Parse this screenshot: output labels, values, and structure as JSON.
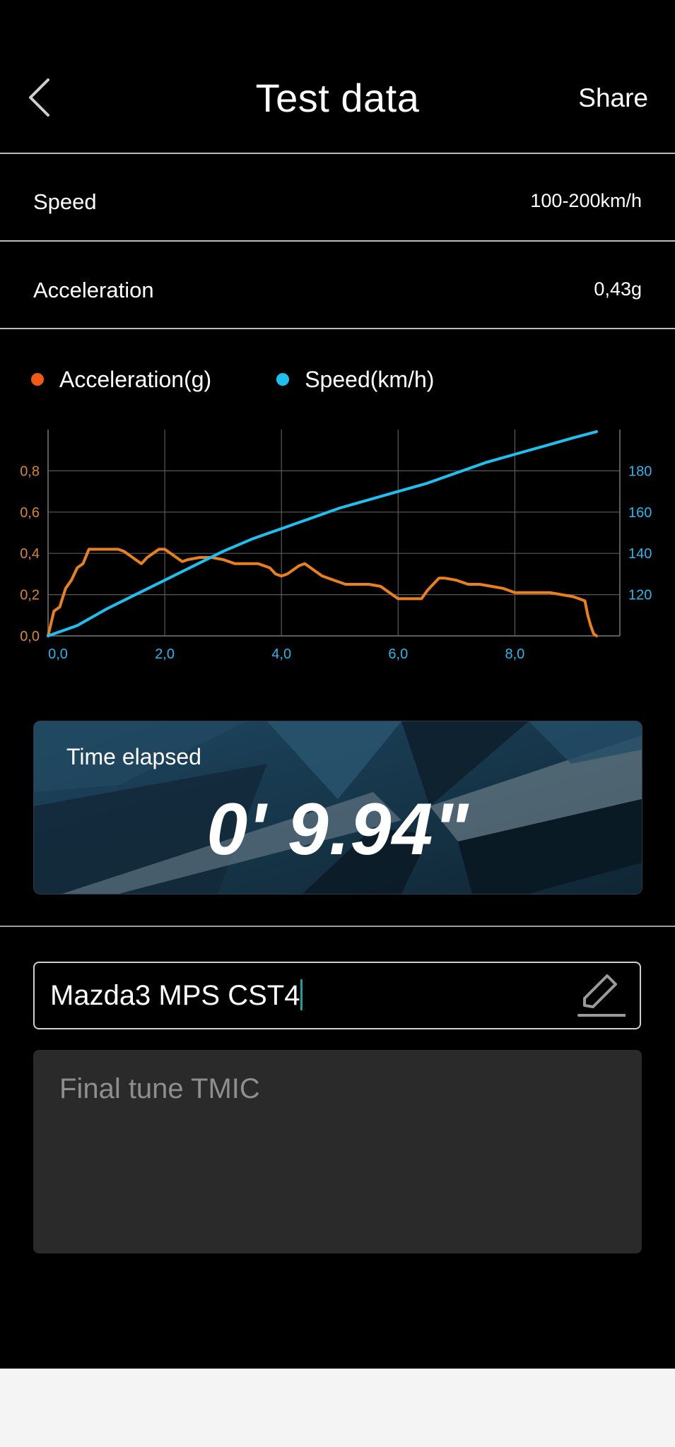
{
  "header": {
    "title": "Test data",
    "share_label": "Share",
    "back_icon": "chevron-left-icon"
  },
  "rows": [
    {
      "label": "Speed",
      "value": "100-200km/h"
    },
    {
      "label": "Acceleration",
      "value": "0,43g"
    }
  ],
  "legend": {
    "acceleration": {
      "label": "Acceleration(g)",
      "color": "#f05a14"
    },
    "speed": {
      "label": "Speed(km/h)",
      "color": "#1ec0f0"
    }
  },
  "chart_data": {
    "type": "line",
    "x_ticks": [
      "0,0",
      "2,0",
      "4,0",
      "6,0",
      "8,0"
    ],
    "xlim": [
      0,
      9.8
    ],
    "y_left_ticks": [
      "0,0",
      "0,2",
      "0,4",
      "0,6",
      "0,8"
    ],
    "ylim_left": [
      0,
      1.0
    ],
    "y_right_ticks": [
      "120",
      "140",
      "160",
      "180"
    ],
    "ylim_right": [
      100,
      200
    ],
    "grid": true,
    "series": [
      {
        "name": "Acceleration(g)",
        "axis": "left",
        "color": "#e8801e",
        "x": [
          0.0,
          0.1,
          0.2,
          0.3,
          0.4,
          0.5,
          0.6,
          0.7,
          0.8,
          1.0,
          1.2,
          1.3,
          1.4,
          1.5,
          1.6,
          1.7,
          1.8,
          1.9,
          2.0,
          2.1,
          2.2,
          2.3,
          2.4,
          2.6,
          2.8,
          3.0,
          3.2,
          3.4,
          3.6,
          3.8,
          3.9,
          4.0,
          4.1,
          4.2,
          4.3,
          4.4,
          4.5,
          4.6,
          4.7,
          4.9,
          5.1,
          5.3,
          5.5,
          5.7,
          5.8,
          5.9,
          6.0,
          6.2,
          6.4,
          6.5,
          6.6,
          6.7,
          6.8,
          7.0,
          7.2,
          7.4,
          7.6,
          7.8,
          8.0,
          8.2,
          8.4,
          8.6,
          8.8,
          9.0,
          9.1,
          9.2,
          9.25,
          9.3,
          9.35,
          9.4
        ],
        "values": [
          0.0,
          0.12,
          0.14,
          0.23,
          0.27,
          0.33,
          0.35,
          0.42,
          0.42,
          0.42,
          0.42,
          0.41,
          0.39,
          0.37,
          0.35,
          0.38,
          0.4,
          0.42,
          0.42,
          0.4,
          0.38,
          0.36,
          0.37,
          0.38,
          0.38,
          0.37,
          0.35,
          0.35,
          0.35,
          0.33,
          0.3,
          0.29,
          0.3,
          0.32,
          0.34,
          0.35,
          0.33,
          0.31,
          0.29,
          0.27,
          0.25,
          0.25,
          0.25,
          0.24,
          0.22,
          0.2,
          0.18,
          0.18,
          0.18,
          0.22,
          0.25,
          0.28,
          0.28,
          0.27,
          0.25,
          0.25,
          0.24,
          0.23,
          0.21,
          0.21,
          0.21,
          0.21,
          0.2,
          0.19,
          0.18,
          0.17,
          0.1,
          0.05,
          0.01,
          0.0
        ]
      },
      {
        "name": "Speed(km/h)",
        "axis": "right",
        "color": "#1ec0f0",
        "x": [
          0.0,
          0.5,
          1.0,
          1.5,
          2.0,
          2.5,
          3.0,
          3.5,
          4.0,
          4.5,
          5.0,
          5.5,
          6.0,
          6.5,
          7.0,
          7.5,
          8.0,
          8.5,
          9.0,
          9.4
        ],
        "values": [
          100,
          105,
          113,
          120,
          127,
          134,
          141,
          147,
          152,
          157,
          162,
          166,
          170,
          174,
          179,
          184,
          188,
          192,
          196,
          199
        ]
      }
    ]
  },
  "timer": {
    "label": "Time elapsed",
    "value": "0' 9.94\""
  },
  "name_field": {
    "value": "Mazda3 MPS CST4",
    "edit_icon": "pencil-icon"
  },
  "notes": {
    "placeholder": "Final tune TMIC"
  }
}
